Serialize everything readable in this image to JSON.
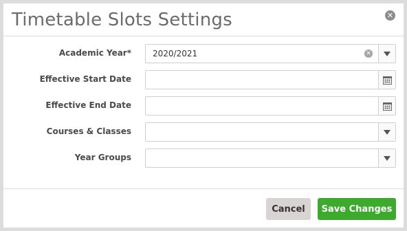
{
  "dialog": {
    "title": "Timetable Slots Settings"
  },
  "form": {
    "academic_year": {
      "label": "Academic Year*",
      "value": "2020/2021"
    },
    "effective_start_date": {
      "label": "Effective Start Date",
      "value": ""
    },
    "effective_end_date": {
      "label": "Effective End Date",
      "value": ""
    },
    "courses_classes": {
      "label": "Courses & Classes",
      "value": ""
    },
    "year_groups": {
      "label": "Year Groups",
      "value": ""
    }
  },
  "footer": {
    "cancel_label": "Cancel",
    "save_label": "Save Changes"
  },
  "icons": {
    "close": "close-icon",
    "clear": "clear-icon",
    "dropdown": "chevron-down-icon",
    "calendar": "calendar-icon"
  },
  "colors": {
    "save_button": "#3daa2d",
    "cancel_button": "#d7d4d2",
    "title_text": "#6b6b6b"
  }
}
